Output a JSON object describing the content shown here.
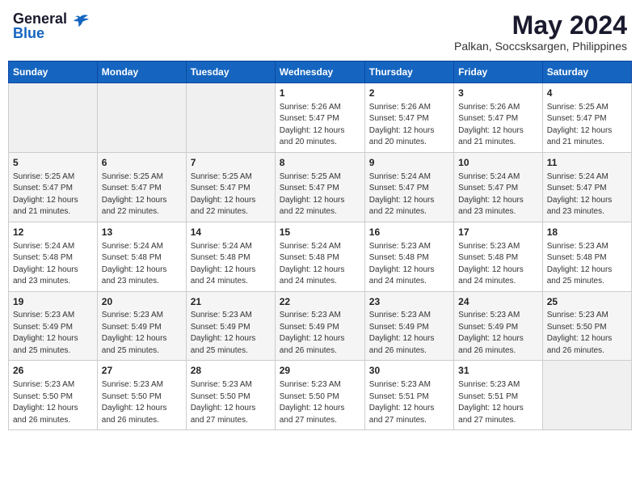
{
  "logo": {
    "general": "General",
    "blue": "Blue"
  },
  "title": "May 2024",
  "location": "Palkan, Soccsksargen, Philippines",
  "weekdays": [
    "Sunday",
    "Monday",
    "Tuesday",
    "Wednesday",
    "Thursday",
    "Friday",
    "Saturday"
  ],
  "weeks": [
    [
      {
        "day": "",
        "info": ""
      },
      {
        "day": "",
        "info": ""
      },
      {
        "day": "",
        "info": ""
      },
      {
        "day": "1",
        "info": "Sunrise: 5:26 AM\nSunset: 5:47 PM\nDaylight: 12 hours and 20 minutes."
      },
      {
        "day": "2",
        "info": "Sunrise: 5:26 AM\nSunset: 5:47 PM\nDaylight: 12 hours and 20 minutes."
      },
      {
        "day": "3",
        "info": "Sunrise: 5:26 AM\nSunset: 5:47 PM\nDaylight: 12 hours and 21 minutes."
      },
      {
        "day": "4",
        "info": "Sunrise: 5:25 AM\nSunset: 5:47 PM\nDaylight: 12 hours and 21 minutes."
      }
    ],
    [
      {
        "day": "5",
        "info": "Sunrise: 5:25 AM\nSunset: 5:47 PM\nDaylight: 12 hours and 21 minutes."
      },
      {
        "day": "6",
        "info": "Sunrise: 5:25 AM\nSunset: 5:47 PM\nDaylight: 12 hours and 22 minutes."
      },
      {
        "day": "7",
        "info": "Sunrise: 5:25 AM\nSunset: 5:47 PM\nDaylight: 12 hours and 22 minutes."
      },
      {
        "day": "8",
        "info": "Sunrise: 5:25 AM\nSunset: 5:47 PM\nDaylight: 12 hours and 22 minutes."
      },
      {
        "day": "9",
        "info": "Sunrise: 5:24 AM\nSunset: 5:47 PM\nDaylight: 12 hours and 22 minutes."
      },
      {
        "day": "10",
        "info": "Sunrise: 5:24 AM\nSunset: 5:47 PM\nDaylight: 12 hours and 23 minutes."
      },
      {
        "day": "11",
        "info": "Sunrise: 5:24 AM\nSunset: 5:47 PM\nDaylight: 12 hours and 23 minutes."
      }
    ],
    [
      {
        "day": "12",
        "info": "Sunrise: 5:24 AM\nSunset: 5:48 PM\nDaylight: 12 hours and 23 minutes."
      },
      {
        "day": "13",
        "info": "Sunrise: 5:24 AM\nSunset: 5:48 PM\nDaylight: 12 hours and 23 minutes."
      },
      {
        "day": "14",
        "info": "Sunrise: 5:24 AM\nSunset: 5:48 PM\nDaylight: 12 hours and 24 minutes."
      },
      {
        "day": "15",
        "info": "Sunrise: 5:24 AM\nSunset: 5:48 PM\nDaylight: 12 hours and 24 minutes."
      },
      {
        "day": "16",
        "info": "Sunrise: 5:23 AM\nSunset: 5:48 PM\nDaylight: 12 hours and 24 minutes."
      },
      {
        "day": "17",
        "info": "Sunrise: 5:23 AM\nSunset: 5:48 PM\nDaylight: 12 hours and 24 minutes."
      },
      {
        "day": "18",
        "info": "Sunrise: 5:23 AM\nSunset: 5:48 PM\nDaylight: 12 hours and 25 minutes."
      }
    ],
    [
      {
        "day": "19",
        "info": "Sunrise: 5:23 AM\nSunset: 5:49 PM\nDaylight: 12 hours and 25 minutes."
      },
      {
        "day": "20",
        "info": "Sunrise: 5:23 AM\nSunset: 5:49 PM\nDaylight: 12 hours and 25 minutes."
      },
      {
        "day": "21",
        "info": "Sunrise: 5:23 AM\nSunset: 5:49 PM\nDaylight: 12 hours and 25 minutes."
      },
      {
        "day": "22",
        "info": "Sunrise: 5:23 AM\nSunset: 5:49 PM\nDaylight: 12 hours and 26 minutes."
      },
      {
        "day": "23",
        "info": "Sunrise: 5:23 AM\nSunset: 5:49 PM\nDaylight: 12 hours and 26 minutes."
      },
      {
        "day": "24",
        "info": "Sunrise: 5:23 AM\nSunset: 5:49 PM\nDaylight: 12 hours and 26 minutes."
      },
      {
        "day": "25",
        "info": "Sunrise: 5:23 AM\nSunset: 5:50 PM\nDaylight: 12 hours and 26 minutes."
      }
    ],
    [
      {
        "day": "26",
        "info": "Sunrise: 5:23 AM\nSunset: 5:50 PM\nDaylight: 12 hours and 26 minutes."
      },
      {
        "day": "27",
        "info": "Sunrise: 5:23 AM\nSunset: 5:50 PM\nDaylight: 12 hours and 26 minutes."
      },
      {
        "day": "28",
        "info": "Sunrise: 5:23 AM\nSunset: 5:50 PM\nDaylight: 12 hours and 27 minutes."
      },
      {
        "day": "29",
        "info": "Sunrise: 5:23 AM\nSunset: 5:50 PM\nDaylight: 12 hours and 27 minutes."
      },
      {
        "day": "30",
        "info": "Sunrise: 5:23 AM\nSunset: 5:51 PM\nDaylight: 12 hours and 27 minutes."
      },
      {
        "day": "31",
        "info": "Sunrise: 5:23 AM\nSunset: 5:51 PM\nDaylight: 12 hours and 27 minutes."
      },
      {
        "day": "",
        "info": ""
      }
    ]
  ]
}
